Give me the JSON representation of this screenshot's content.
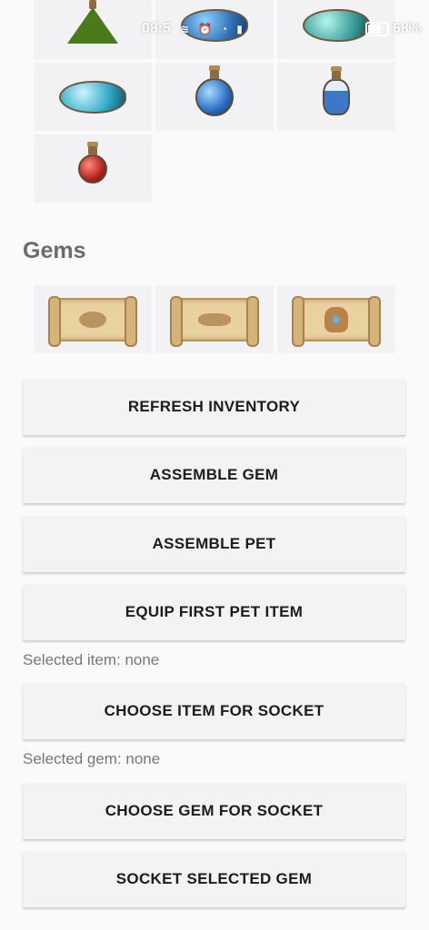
{
  "status_bar": {
    "time": "08:5",
    "battery": "68%",
    "icons": [
      "network-speed-icon",
      "alarm-icon",
      "wifi-icon",
      "signal-icon",
      "battery-icon"
    ]
  },
  "potions": {
    "items": [
      {
        "icon": "green-potion-icon",
        "color": "#4a7a1c"
      },
      {
        "icon": "blue-potion-icon",
        "color": "#2f6fb5"
      },
      {
        "icon": "teal-potion-icon",
        "color": "#3a9e9a"
      },
      {
        "icon": "cyan-potion-icon",
        "color": "#2fa7c4"
      },
      {
        "icon": "blue-round-potion-icon",
        "color": "#2a6bc2"
      },
      {
        "icon": "blue-vial-potion-icon",
        "color": "#3c77c9"
      },
      {
        "icon": "red-potion-icon",
        "color": "#b3231f"
      }
    ]
  },
  "gems": {
    "title": "Gems",
    "items": [
      {
        "icon": "scroll-nest-icon"
      },
      {
        "icon": "scroll-hand-pointing-icon"
      },
      {
        "icon": "scroll-hand-gem-icon"
      }
    ]
  },
  "buttons": {
    "refresh_inventory": "REFRESH INVENTORY",
    "assemble_gem": "ASSEMBLE GEM",
    "assemble_pet": "ASSEMBLE PET",
    "equip_first_pet_item": "EQUIP FIRST PET ITEM",
    "choose_item_for_socket": "CHOOSE ITEM FOR SOCKET",
    "choose_gem_for_socket": "CHOOSE GEM FOR SOCKET",
    "socket_selected_gem": "SOCKET SELECTED GEM"
  },
  "selection": {
    "selected_item": "Selected item: none",
    "selected_gem": "Selected gem: none"
  }
}
